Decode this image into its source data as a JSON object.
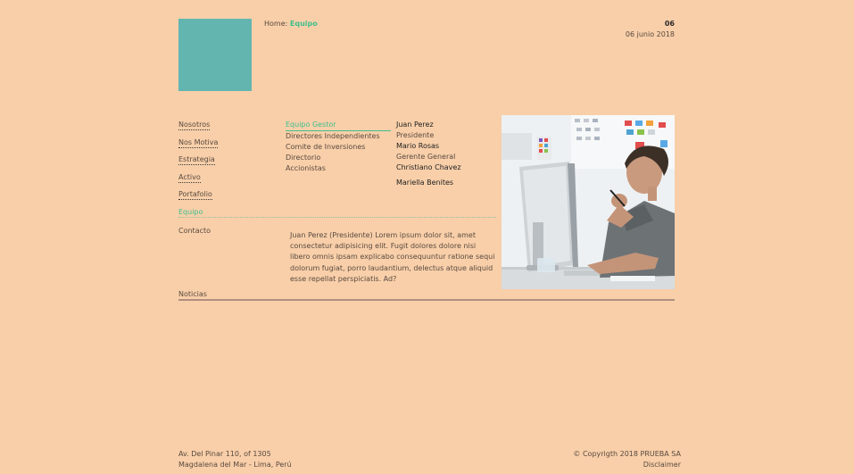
{
  "header": {
    "breadcrumb_prefix": "Home:",
    "breadcrumb_current": "Equipo",
    "date_number": "06",
    "date_text": "06 junio 2018"
  },
  "nav": [
    {
      "label": "Nosotros"
    },
    {
      "label": "Nos Motiva"
    },
    {
      "label": "Estrategia"
    },
    {
      "label": "Activo"
    },
    {
      "label": "Portafolio"
    },
    {
      "label": "Equipo"
    },
    {
      "label": "Contacto"
    },
    {
      "label": "Noticias"
    }
  ],
  "subnav": [
    {
      "label": "Equipo Gestor"
    },
    {
      "label": "Directores Independientes"
    },
    {
      "label": "Comite de Inversiones"
    },
    {
      "label": "Directorio"
    },
    {
      "label": "Accionistas"
    }
  ],
  "people": [
    {
      "name": "Juan Perez",
      "role": "Presidente"
    },
    {
      "name": "Mario Rosas",
      "role": "Gerente General"
    },
    {
      "name": "Christiano Chavez"
    },
    {
      "name": "Mariella Benites"
    }
  ],
  "bio": "Juan Perez (Presidente) Lorem ipsum dolor sit, amet consectetur adipisicing elit. Fugit dolores dolore nisi libero omnis ipsam explicabo consequuntur ratione sequi dolorum fugiat, porro laudantium, delectus atque aliquid esse repellat perspiciatis. Ad?",
  "footer": {
    "address_line1": "Av. Del Pinar 110, of 1305",
    "address_line2": "Magdalena del Mar - Lima, Perú",
    "copyright": "© Copyrigth 2018 PRUEBA SA",
    "disclaimer": "Disclaimer"
  },
  "colors": {
    "background": "#F8CFA9",
    "logo": "#63B5B0",
    "accent": "#3FBF8F"
  }
}
